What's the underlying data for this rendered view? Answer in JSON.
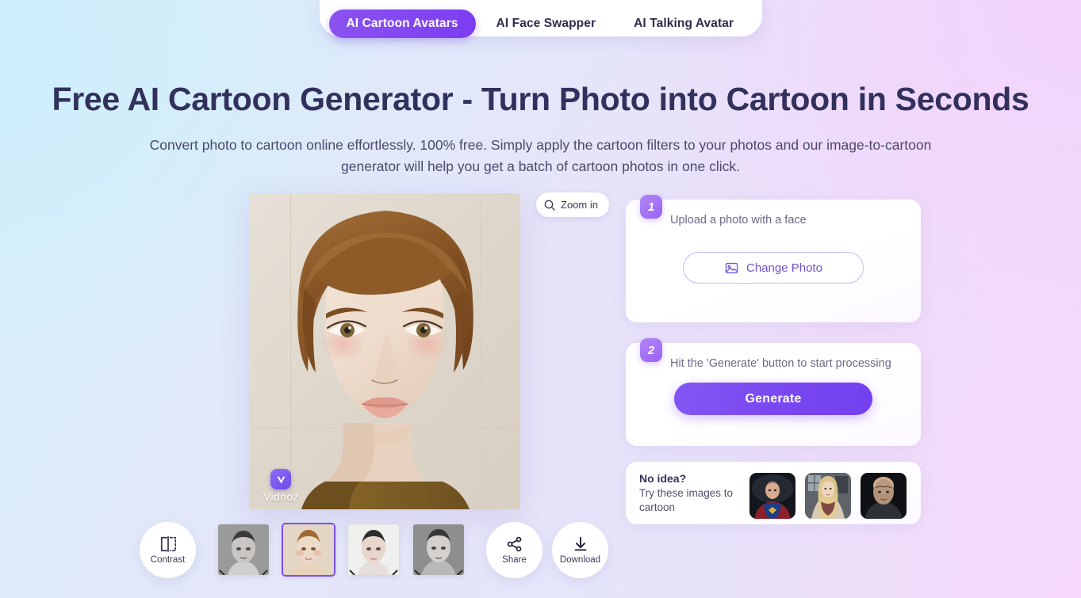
{
  "tabs": [
    {
      "label": "AI Cartoon Avatars",
      "active": true
    },
    {
      "label": "AI Face Swapper",
      "active": false
    },
    {
      "label": "AI Talking Avatar",
      "active": false
    }
  ],
  "hero": {
    "title": "Free AI Cartoon Generator - Turn Photo into Cartoon in Seconds",
    "subtitle": "Convert photo to cartoon online effortlessly. 100% free. Simply apply the cartoon filters to your photos and our image-to-cartoon generator will help you get a batch of cartoon photos in one click."
  },
  "preview": {
    "zoom_button_label": "Zoom in",
    "zoom_icon": "magnifier-icon",
    "watermark_text": "Vidnoz",
    "watermark_logo": "vidnoz-v-logo"
  },
  "toolbar": {
    "contrast_label": "Contrast",
    "contrast_icon": "contrast-split-icon",
    "share_label": "Share",
    "share_icon": "share-nodes-icon",
    "download_label": "Download",
    "download_icon": "download-arrow-icon",
    "thumbnails": [
      {
        "name": "result-1",
        "selected": false
      },
      {
        "name": "result-2",
        "selected": true
      },
      {
        "name": "result-3",
        "selected": false
      },
      {
        "name": "result-4",
        "selected": false
      }
    ]
  },
  "steps": [
    {
      "number": "1",
      "text": "Upload a photo with a face",
      "button_label": "Change Photo",
      "button_icon": "image-photo-icon"
    },
    {
      "number": "2",
      "text": "Hit the 'Generate' button to start processing",
      "button_label": "Generate"
    }
  ],
  "no_idea": {
    "title": "No idea?",
    "subtitle": "Try these images to cartoon",
    "samples": [
      {
        "name": "sample-superhero"
      },
      {
        "name": "sample-blonde-woman"
      },
      {
        "name": "sample-bald-man"
      }
    ]
  },
  "colors": {
    "accent": "#7c3cf0",
    "accent_light": "#9a63f2",
    "title": "#32305c",
    "body_text": "#4b4a6b",
    "card_bg": "#ffffff"
  }
}
